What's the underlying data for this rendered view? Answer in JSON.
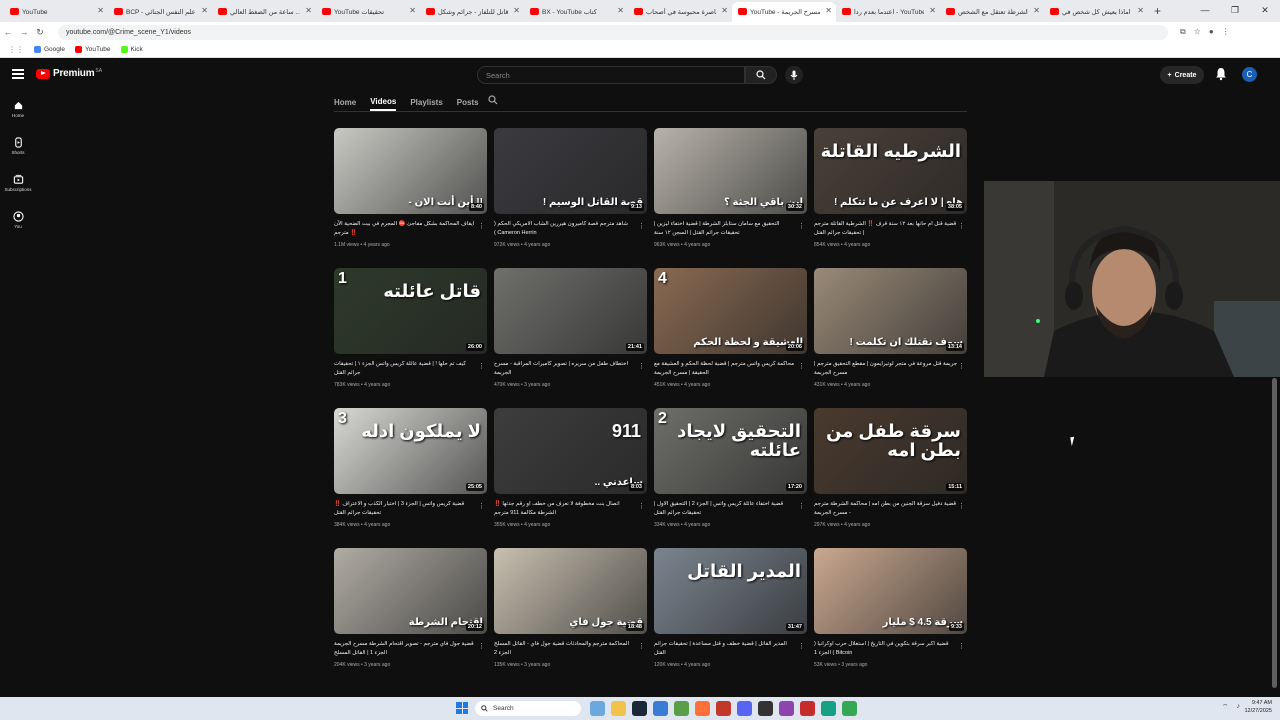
{
  "browser": {
    "tabs": [
      {
        "label": "YouTube",
        "active": false
      },
      {
        "label": "BCP - علم النفس الجنائي",
        "active": false
      },
      {
        "label": "ساعة من الضغط العالي ...",
        "active": false
      },
      {
        "label": "YouTube تحقيقات",
        "active": false
      },
      {
        "label": "قاتل للتلفاز - جرائم وشكل",
        "active": false
      },
      {
        "label": "BX - YouTube كتاب",
        "active": false
      },
      {
        "label": "محاصرة محبوسة في أصحاب",
        "active": false
      },
      {
        "label": "YouTube - مسرح الجريمة",
        "active": true
      },
      {
        "label": "اعتدما بعدم ردا - YouTube",
        "active": false
      },
      {
        "label": "الشرطة تعتقل مع الشخص",
        "active": false
      },
      {
        "label": "اماذا يعيش كل شخص في",
        "active": false
      }
    ],
    "new_tab": "+",
    "url": "youtube.com/@Crime_scene_Y1/videos",
    "bookmarks": [
      {
        "label": "Google",
        "color": "#4285f4"
      },
      {
        "label": "YouTube",
        "color": "#ff0000"
      },
      {
        "label": "Kick",
        "color": "#53fc18"
      }
    ],
    "window_controls": [
      "—",
      "❐",
      "✕"
    ]
  },
  "youtube": {
    "logo_text": "Premium",
    "logo_region": "SA",
    "search_placeholder": "Search",
    "create_label": "Create",
    "avatar_letter": "C"
  },
  "sidebar": [
    {
      "label": "Home",
      "icon": "home-icon"
    },
    {
      "label": "Shorts",
      "icon": "shorts-icon"
    },
    {
      "label": "Subscriptions",
      "icon": "subscriptions-icon"
    },
    {
      "label": "You",
      "icon": "you-icon"
    }
  ],
  "channel_tabs": [
    {
      "label": "Home",
      "active": false
    },
    {
      "label": "Videos",
      "active": true
    },
    {
      "label": "Playlists",
      "active": false
    },
    {
      "label": "Posts",
      "active": false
    }
  ],
  "videos": [
    {
      "title": "ايقاف المحاكمة بشكل مفاجئ ⛔ المجرم في بيت الضحية الآن ‼️ مترجم",
      "views": "1.1M views",
      "age": "4 years ago",
      "duration": "8:40",
      "overlay": "!! أين أنت الان -",
      "big": "",
      "num": "",
      "bg": "#c9c9c4"
    },
    {
      "title": "شاهد مترجم قصة كاميرون هيررين الشاب الامريكي الحكم ( Cameron Herrin )",
      "views": "972K views",
      "age": "4 years ago",
      "duration": "9:13",
      "overlay": "قصة القاتل الوسيم !",
      "big": "",
      "num": "",
      "bg": "#3b3a3f"
    },
    {
      "title": "التحقيق مع سامان ستابلز الشرطة | قضية اختفاء ليزين | تحقيقات جرائم القتل | السجن ١٢ سنة",
      "views": "963K views",
      "age": "4 years ago",
      "duration": "30:32",
      "overlay": "اين باقي الجثة ؟",
      "big": "",
      "num": "",
      "bg": "#b8b4aa"
    },
    {
      "title": "قضية قتل ام حانها بعد ١٢ سنة قرف ‼️ الشرطية القاتلة مترجم | تحقيقات جرائم القتل",
      "views": "854K views",
      "age": "4 years ago",
      "duration": "38:05",
      "overlay": "هاه | لا اعرف عن ما تتكلم !",
      "big": "الشرطيه القاتلة",
      "num": "",
      "bg": "#4a4038"
    },
    {
      "title": "كيف تم حلها ! | قضية عائلة كريس واتس الجزء ١ | تحقيقات جرائم القتل",
      "views": "783K views",
      "age": "4 years ago",
      "duration": "26:00",
      "overlay": "",
      "big": "قاتل عائلته",
      "num": "1",
      "bg": "#2e3a2a"
    },
    {
      "title": "اختطاف طفل من سريره | تصوير كاميرات المراقبة - مسرح الجريمة",
      "views": "470K views",
      "age": "3 years ago",
      "duration": "21:41",
      "overlay": "",
      "big": "",
      "num": "",
      "bg": "#6f6f6c"
    },
    {
      "title": "محاكمة كريس واتس مترجم | قضية لحظة الحكم و العشيقة مع الحقيقة | مسرح الجريمة",
      "views": "451K views",
      "age": "4 years ago",
      "duration": "20:06",
      "overlay": "العشيقة و لحظة الحكم",
      "big": "",
      "num": "4",
      "bg": "#8a6a52"
    },
    {
      "title": "جريمة قتل مروعة في متجر لوتيرايمون | مقطع التحقيق مترجم | مسرح الجريمة",
      "views": "431K views",
      "age": "4 years ago",
      "duration": "13:14",
      "overlay": "سوف نقتلك ان تكلمت !",
      "big": "",
      "num": "",
      "bg": "#9a8a78"
    },
    {
      "title": "قضية كريس واتس | الجزء 3 | اختبار الكذب و الاعتراف ‼️ تحقيقات جرائم القتل",
      "views": "384K views",
      "age": "4 years ago",
      "duration": "25:05",
      "overlay": "",
      "big": "لا يملكون ادله",
      "num": "3",
      "bg": "#d8d8d4"
    },
    {
      "title": "اتصال بنت مخطوفة لا تعرف من خطف او رقم جدتها ‼️ الشرطة مكالمة 911 مترجم",
      "views": "355K views",
      "age": "4 years ago",
      "duration": "8:03",
      "overlay": "ساعدني ..",
      "big": "911",
      "num": "",
      "bg": "#3d3d3d"
    },
    {
      "title": "قضية اختفاء عائلة كريس واتس | الجزء 2 | التحقيق الاول | تحقيقات جرائم القتل",
      "views": "334K views",
      "age": "4 years ago",
      "duration": "17:20",
      "overlay": "",
      "big": "التحقيق لايجاد عائلته",
      "num": "2",
      "bg": "#6e6e6a"
    },
    {
      "title": "قضية دفيل سرقة الجنين من بطن امه | محاكمة الشرطة مترجم - مسرح الجريمة",
      "views": "297K views",
      "age": "4 years ago",
      "duration": "15:11",
      "overlay": "",
      "big": "سرقة طفل من بطن امه",
      "num": "",
      "bg": "#4a3a2e"
    },
    {
      "title": "قضية جول فاي مترجم - تصوير اقتحام الشرطة مسرح الجريمة الجزء 1 | القاتل المسلح",
      "views": "204K views",
      "age": "3 years ago",
      "duration": "20:12",
      "overlay": "اقتحام الشرطة",
      "big": "",
      "num": "",
      "bg": "#b0aca4"
    },
    {
      "title": "المحاكمة مترجم والمحادثات قضية جول فاي - القاتل المسلح الجزء 2",
      "views": "135K views",
      "age": "3 years ago",
      "duration": "18:48",
      "overlay": "قضية جول فاي",
      "big": "",
      "num": "",
      "bg": "#c8c0b0"
    },
    {
      "title": "المدير القاتل | قضية خطف و قتل مساعدة | تحقيقات جرائم القتل",
      "views": "120K views",
      "age": "4 years ago",
      "duration": "31:47",
      "overlay": "",
      "big": "المدير القاتل",
      "num": "",
      "bg": "#7b8590"
    },
    {
      "title": "قضية اكبر سرقة بتكوين في التاريخ | استغلال حرب اوكرانيا ( Bitcoin ) الجزء 1",
      "views": "53K views",
      "age": "3 years ago",
      "duration": "9:33",
      "overlay": "سرقة 4.5 $ مليار",
      "big": "",
      "num": "",
      "bg": "#caa890"
    }
  ],
  "taskbar": {
    "search_label": "Search",
    "time": "9:47 AM",
    "date": "12/27/2025"
  }
}
